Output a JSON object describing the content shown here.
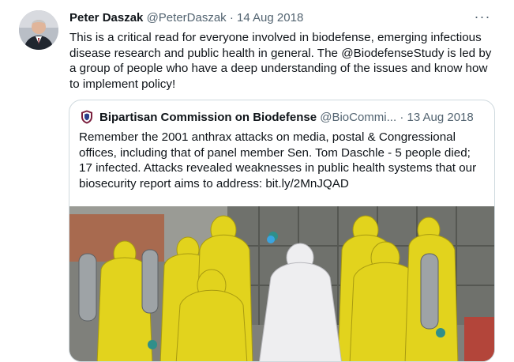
{
  "tweet": {
    "author_name": "Peter Daszak",
    "author_handle": "@PeterDaszak",
    "separator": "·",
    "date": "14 Aug 2018",
    "more_icon": "more-horizontal-icon",
    "text": "This is a critical read for everyone involved in biodefense, emerging infectious disease research and public health in general.  The @BiodefenseStudy is led by a group of people who have a deep understanding of the issues and know how to implement policy!"
  },
  "quoted": {
    "author_name": "Bipartisan Commission on Biodefense",
    "author_handle": "@BioCommi...",
    "separator": "·",
    "date": "13 Aug 2018",
    "logo_icon": "shield-logo-icon",
    "text": "Remember the 2001 anthrax attacks on media, postal & Congressional offices, including that of panel member Sen. Tom Daschle - 5 people died; 17 infected. Attacks revealed weaknesses in public health systems that our biosecurity report aims to address: bit.ly/2MnJQAD"
  },
  "colors": {
    "text": "#0f1419",
    "secondary": "#536471",
    "border": "#cfd9de",
    "hazmat_yellow": "#e3d21c"
  }
}
